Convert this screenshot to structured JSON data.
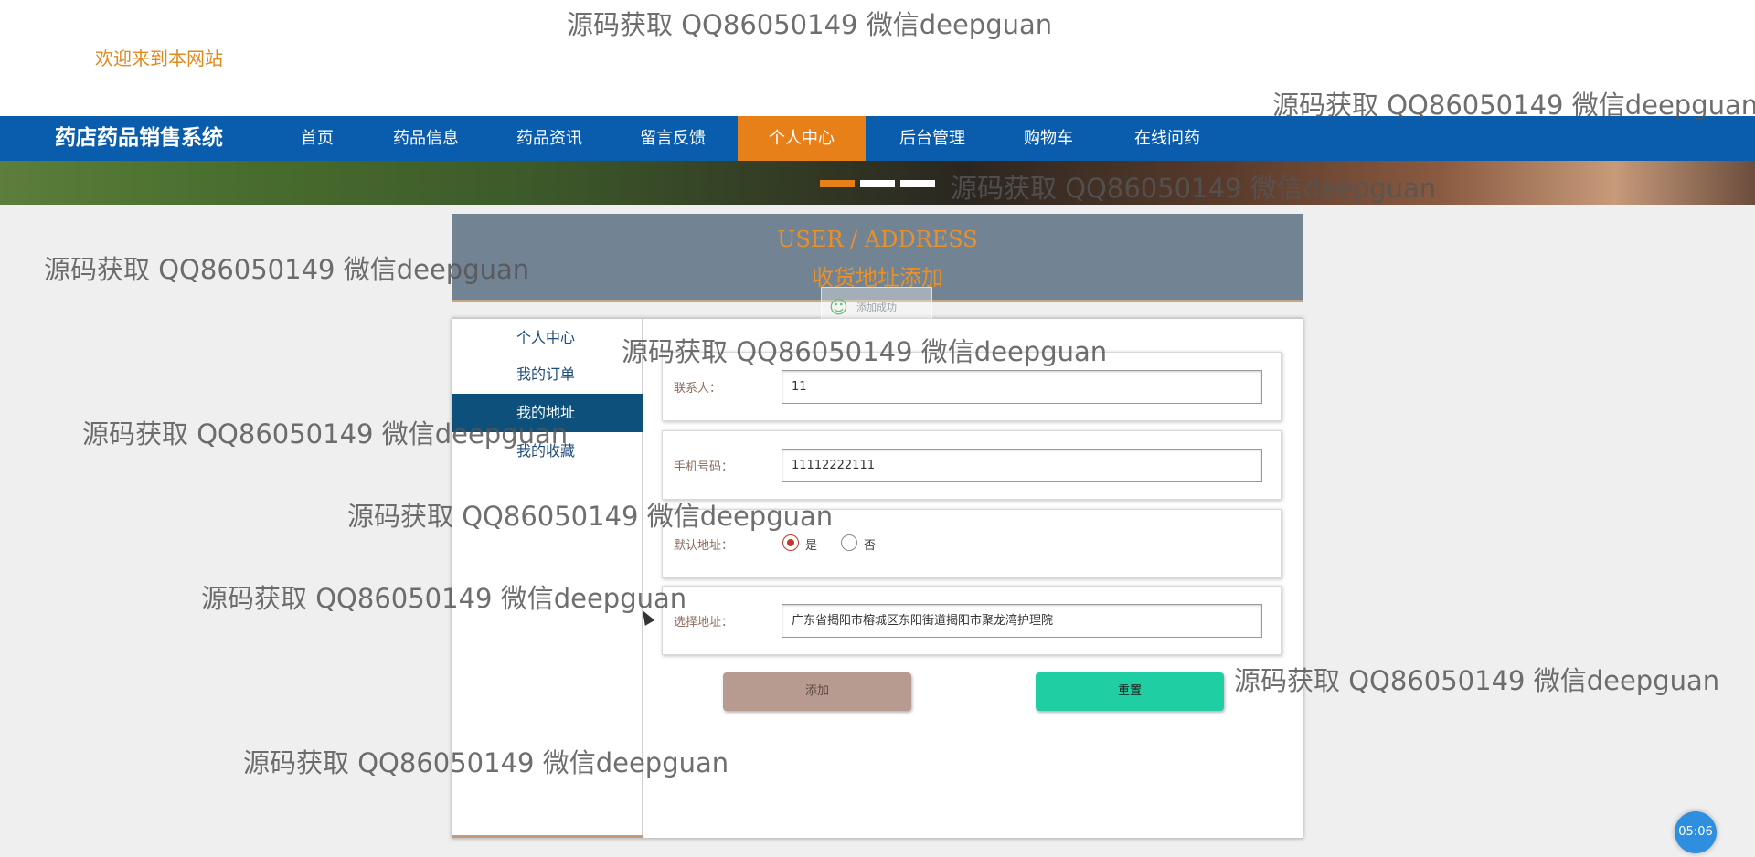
{
  "header": {
    "welcome": "欢迎来到本网站"
  },
  "nav": {
    "brand": "药店药品销售系统",
    "items": [
      "首页",
      "药品信息",
      "药品资讯",
      "留言反馈",
      "个人中心",
      "后台管理",
      "购物车",
      "在线问药"
    ],
    "active": "个人中心",
    "accent_color": "#e8801a",
    "bar_color": "#0a5cac"
  },
  "carousel": {
    "indicator_count": 3,
    "active_index": 0
  },
  "page_title": {
    "en": "USER / ADDRESS",
    "zh": "收货地址添加"
  },
  "toast": {
    "text": "添加成功",
    "icon": "smile-icon"
  },
  "sidebar": {
    "items": [
      "个人中心",
      "我的订单",
      "我的地址",
      "我的收藏"
    ],
    "active": "我的地址"
  },
  "form": {
    "contact": {
      "label": "联系人：",
      "value": "11"
    },
    "phone": {
      "label": "手机号码：",
      "value": "11112222111"
    },
    "default": {
      "label": "默认地址：",
      "options": [
        "是",
        "否"
      ],
      "selected": "是"
    },
    "address": {
      "label": "选择地址：",
      "value": "广东省揭阳市榕城区东阳街道揭阳市聚龙湾护理院"
    },
    "add_button": "添加",
    "reset_button": "重置"
  },
  "watermark": "源码获取 QQ86050149 微信deepguan",
  "clock": "05:06"
}
